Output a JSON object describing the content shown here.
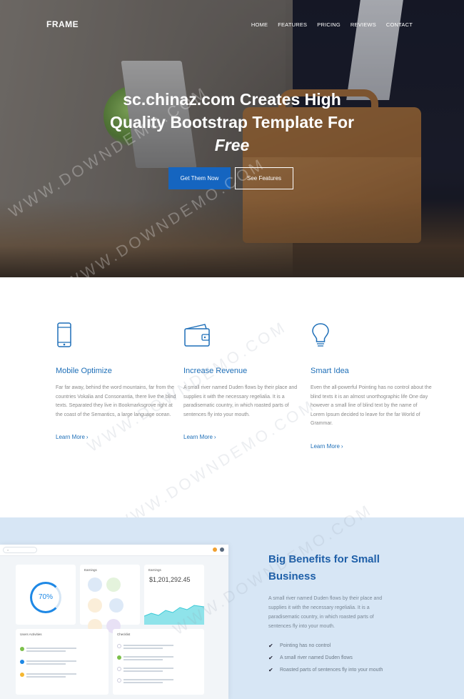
{
  "nav": {
    "brand": "FRAME",
    "items": [
      "HOME",
      "FEATURES",
      "PRICING",
      "REVIEWS",
      "CONTACT"
    ]
  },
  "hero": {
    "title_line1": "sc.chinaz.com Creates High",
    "title_line2": "Quality Bootstrap Template For",
    "title_emphasis": "Free",
    "primary_button": "Get Them Now",
    "secondary_button": "See Features"
  },
  "features": [
    {
      "icon": "smartphone-icon",
      "title": "Mobile Optimize",
      "text": "Far far away, behind the word mountains, far from the countries Vokalia and Consonantia, there live the blind texts. Separated they live in Bookmarksgrove right at the coast of the Semantics, a large language ocean.",
      "link": "Learn More"
    },
    {
      "icon": "wallet-icon",
      "title": "Increase Revenue",
      "text": "A small river named Duden flows by their place and supplies it with the necessary regelialia. It is a paradisematic country, in which roasted parts of sentences fly into your mouth.",
      "link": "Learn More"
    },
    {
      "icon": "lightbulb-icon",
      "title": "Smart Idea",
      "text": "Even the all-powerful Pointing has no control about the blind texts it is an almost unorthographic life One day however a small line of blind text by the name of Lorem Ipsum decided to leave for the far World of Grammar.",
      "link": "Learn More"
    }
  ],
  "benefits": {
    "title": "Big Benefits for Small Business",
    "text": "A small river named Duden flows by their place and supplies it with the necessary regelialia. It is a paradisematic country, in which roasted parts of sentences fly into your mouth.",
    "items": [
      "Pointing has no control",
      "A small river named Duden flows",
      "Roasted parts of sentences fly into your mouth"
    ]
  },
  "dashboard": {
    "card1_title": "",
    "gauge_value": "70%",
    "card2_title": "Earnings",
    "card3_title": "Earnings",
    "money": "$1,201,292.45",
    "card4_title": "Users Activities",
    "card5_title": "Checklist"
  },
  "watermark": "WWW.DOWNDEMO.COM",
  "colors": {
    "accent": "#1565c0",
    "link": "#1e6fb8",
    "benefits_bg": "#d7e6f5"
  }
}
